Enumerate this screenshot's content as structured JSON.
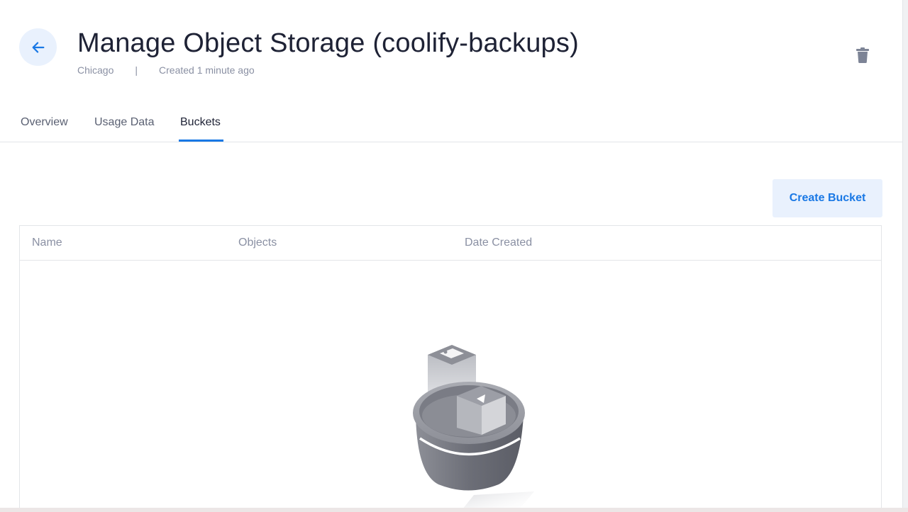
{
  "header": {
    "title": "Manage Object Storage (coolify-backups)",
    "location": "Chicago",
    "separator": "|",
    "created": "Created 1 minute ago",
    "back_icon": "arrow-left-icon",
    "delete_icon": "trash-icon"
  },
  "tabs": [
    {
      "label": "Overview",
      "active": false
    },
    {
      "label": "Usage Data",
      "active": false
    },
    {
      "label": "Buckets",
      "active": true
    }
  ],
  "actions": {
    "create_bucket_label": "Create Bucket"
  },
  "table": {
    "columns": [
      "Name",
      "Objects",
      "Date Created"
    ],
    "rows": []
  },
  "empty_state": {
    "illustration": "bucket-illustration"
  },
  "colors": {
    "accent": "#1978e5",
    "accent_bg": "#e9f1fd",
    "text_primary": "#1e2235",
    "text_muted": "#8a90a3",
    "border": "#e3e5e8"
  }
}
